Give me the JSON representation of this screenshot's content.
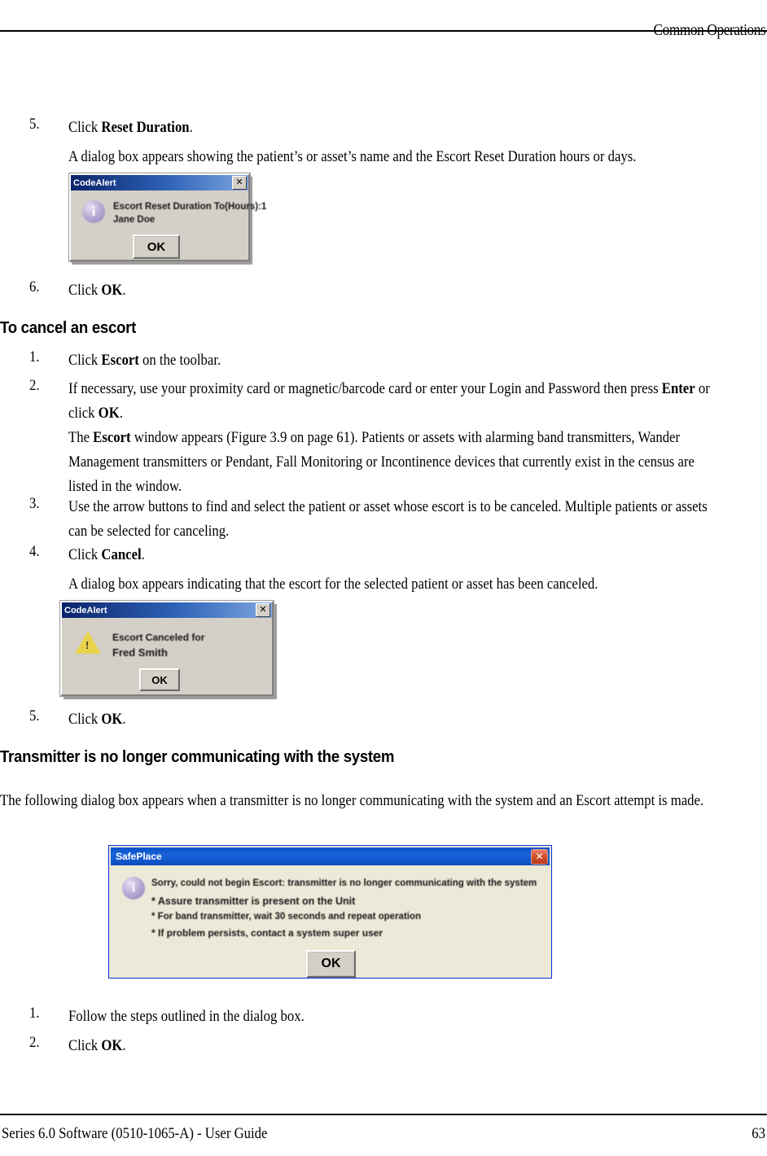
{
  "header": {
    "title": "Common Operations"
  },
  "footer": {
    "left": "Series 6.0 Software (0510-1065-A) - User Guide",
    "page": "63"
  },
  "blocks": {
    "step5_num": "5.",
    "step5_text_pre": "Click ",
    "step5_text_bold": "Reset Duration",
    "step5_text_post": ".",
    "step5_para": "A dialog box appears showing the patient’s or asset’s name and the Escort Reset Duration hours or days.",
    "step6_num": "6.",
    "step6_text_pre": "Click ",
    "step6_text_bold": "OK",
    "step6_text_post": ".",
    "heading_cancel": "To cancel an escort",
    "c1_num": "1.",
    "c1_pre": "Click ",
    "c1_bold": "Escort",
    "c1_post": " on the toolbar.",
    "c2_num": "2.",
    "c2_line1": "If necessary, use your proximity card or magnetic/barcode card or enter your Login and Password then press ",
    "c2_bold1": "Enter",
    "c2_mid": " or click ",
    "c2_bold2": "OK",
    "c2_end": ".",
    "c2_para_pre": "The ",
    "c2_para_bold": "Escort",
    "c2_para_post": " window appears (Figure 3.9 on page 61). Patients or assets with alarming band transmitters, Wander Management transmitters or Pendant, Fall Monitoring or Incontinence devices that currently exist in the census are listed in the window.",
    "c3_num": "3.",
    "c3_text": "Use the arrow buttons to find and select the patient or asset whose escort is to be canceled. Multiple patients or assets can be selected for canceling.",
    "c4_num": "4.",
    "c4_pre": "Click ",
    "c4_bold": "Cancel",
    "c4_post": ".",
    "c4_para": "A dialog box appears indicating that the escort for the selected patient or asset has been canceled.",
    "c5_num": "5.",
    "c5_pre": "Click ",
    "c5_bold": "OK",
    "c5_post": ".",
    "heading_transmitter": "Transmitter is no longer communicating with the system",
    "transmitter_para": "The following dialog box appears when a transmitter is no longer communicating with the system and an Escort attempt is made.",
    "t1_num": "1.",
    "t1_text": "Follow the steps outlined in the dialog box.",
    "t2_num": "2.",
    "t2_pre": "Click ",
    "t2_bold": "OK",
    "t2_post": "."
  },
  "dialog_reset_duration": {
    "title": "CodeAlert",
    "close_label": "✕",
    "icon": "info-icon",
    "message_line1": "Escort Reset Duration To(Hours):1",
    "message_line2": "Jane Doe",
    "ok_label": "OK"
  },
  "dialog_escort_canceled": {
    "title": "CodeAlert",
    "close_label": "✕",
    "icon": "warning-icon",
    "message_line1": "Escort Canceled for",
    "message_line2": "Fred Smith",
    "ok_label": "OK"
  },
  "dialog_safeplace": {
    "title": "SafePlace",
    "close_label": "✕",
    "icon": "info-icon",
    "message_line1": "Sorry, could not begin Escort: transmitter is no longer communicating with the system",
    "message_line2": "* Assure transmitter is present on the Unit",
    "message_line3": "* For band transmitter, wait 30 seconds and repeat operation",
    "message_line4": "* If problem persists, contact a system super user",
    "ok_label": "OK"
  },
  "colors": {
    "titlebar_classic_start": "#0a246a",
    "titlebar_xp": "#0a55c8",
    "dialog_face": "#d4d0c8",
    "dialog_face_xp": "#ece9d8",
    "close_button_xp": "#d4512f",
    "warning_icon": "#e9d24b",
    "info_icon": "#8e80b8"
  }
}
